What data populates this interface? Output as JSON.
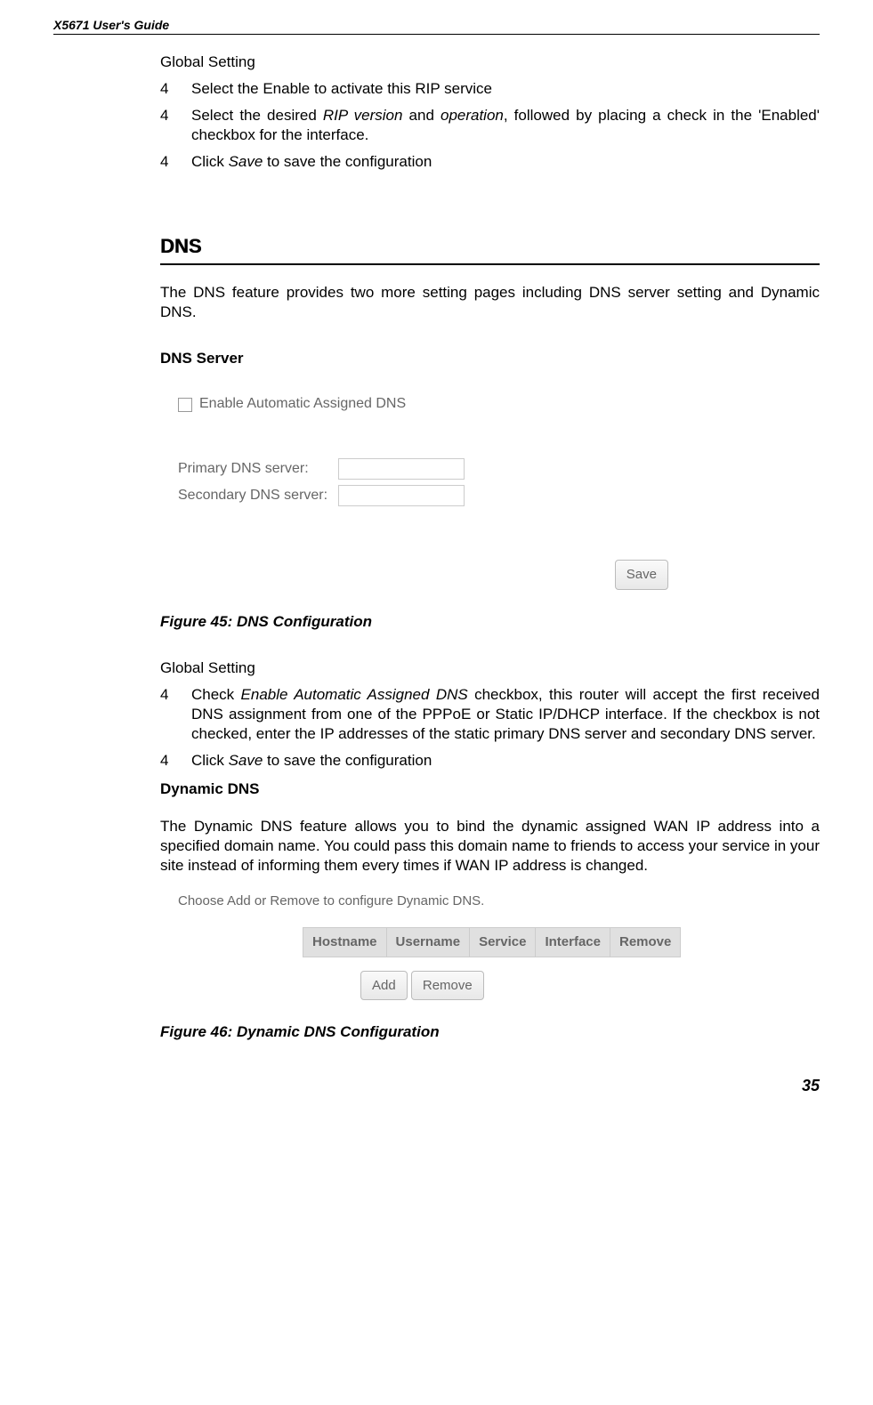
{
  "header": {
    "title": "X5671 User's Guide"
  },
  "intro": {
    "global_setting": "Global Setting",
    "items": [
      {
        "num": "4",
        "prefix": "Select the Enable to activate this RIP service"
      },
      {
        "num": "4",
        "t1": "Select the desired ",
        "i1": "RIP version",
        "t2": " and ",
        "i2": "operation",
        "t3": ", followed by placing a check in the 'Enabled' checkbox for the interface."
      },
      {
        "num": "4",
        "t1": "Click ",
        "i1": "Save",
        "t2": " to save the configuration"
      }
    ]
  },
  "dns_section": {
    "title": "DNS",
    "desc": "The DNS feature provides two more setting pages including DNS server setting and Dynamic DNS.",
    "server_title": "DNS Server",
    "fig45": {
      "enable_label": "Enable Automatic Assigned DNS",
      "primary_label": "Primary DNS server:",
      "secondary_label": "Secondary DNS server:",
      "save": "Save"
    },
    "fig45_caption": "Figure 45: DNS Configuration"
  },
  "global2": {
    "title": "Global Setting",
    "items": [
      {
        "num": "4",
        "t1": "Check ",
        "i1": "Enable Automatic Assigned DNS",
        "t2": " checkbox, this router will accept the first received DNS assignment from one of the PPPoE or Static IP/DHCP interface. If the checkbox is not checked, enter the IP addresses of the static primary DNS server and secondary DNS server."
      },
      {
        "num": "4",
        "t1": "Click ",
        "i1": "Save",
        "t2": " to save the configuration"
      }
    ]
  },
  "ddns": {
    "title": "Dynamic DNS",
    "desc": "The Dynamic DNS feature allows you to bind the dynamic assigned WAN IP address into a specified domain name. You could pass this domain name to friends to access your service in your site instead of informing them every times if WAN IP address is changed.",
    "fig46": {
      "caption_line": "Choose Add or Remove to configure Dynamic DNS.",
      "headers": [
        "Hostname",
        "Username",
        "Service",
        "Interface",
        "Remove"
      ],
      "add": "Add",
      "remove": "Remove"
    },
    "fig46_caption": "Figure 46: Dynamic DNS Configuration"
  },
  "page_number": "35"
}
